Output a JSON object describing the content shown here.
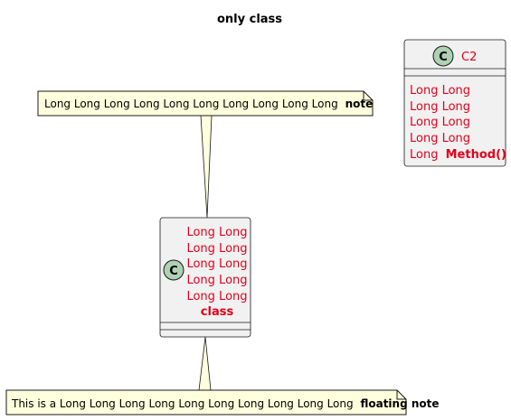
{
  "diagram": {
    "title": "only class",
    "colors": {
      "class_fill": "#F1F1F1",
      "class_border": "#181818",
      "class_text": "#E2001A",
      "note_fill": "#FEFFDD",
      "note_border": "#181818",
      "stereotype_circle": "#ADD1B2",
      "connector": "#181818"
    },
    "note_top": {
      "text": "Long Long Long Long Long Long Long Long Long Long",
      "bold": "note"
    },
    "main_class": {
      "stereotype": "C",
      "name_lines": [
        "Long Long",
        "Long Long",
        "Long Long",
        "Long Long",
        "Long Long"
      ],
      "name_bold": "class"
    },
    "class_c2": {
      "stereotype": "C",
      "name": "C2",
      "method_lines": [
        "Long Long",
        "Long Long",
        "Long Long",
        "Long Long"
      ],
      "method_prefix": "Long",
      "method_bold": "Method()"
    },
    "note_bottom": {
      "text": "This is a Long Long Long Long Long Long Long Long Long Long",
      "bold": "floating note"
    }
  }
}
